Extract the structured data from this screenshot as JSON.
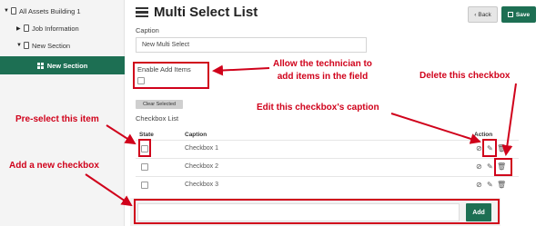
{
  "sidebar": {
    "items": [
      {
        "label": "All Assets Building 1"
      },
      {
        "label": "Job Information"
      },
      {
        "label": "New Section"
      },
      {
        "label": "New Section"
      }
    ]
  },
  "header": {
    "title": "Multi Select List",
    "back_label": "Back",
    "save_label": "Save"
  },
  "form": {
    "caption_label": "Caption",
    "caption_value": "New Multi Select",
    "enable_add_label": "Enable Add Items",
    "clear_selected_label": "Clear Selected",
    "checkbox_list_label": "Checkbox List"
  },
  "table": {
    "headers": {
      "state": "State",
      "caption": "Caption",
      "action": "Action"
    },
    "rows": [
      {
        "caption": "Checkbox 1"
      },
      {
        "caption": "Checkbox 2"
      },
      {
        "caption": "Checkbox 3"
      }
    ]
  },
  "add_row": {
    "button_label": "Add"
  },
  "annotations": {
    "allow_add": "Allow the technician to\nadd items in the field",
    "delete": "Delete this checkbox",
    "edit": "Edit this checkbox's caption",
    "preselect": "Pre-select this item",
    "add_new": "Add a new checkbox"
  },
  "colors": {
    "accent": "#1d6f53",
    "annotation": "#d0021b"
  }
}
